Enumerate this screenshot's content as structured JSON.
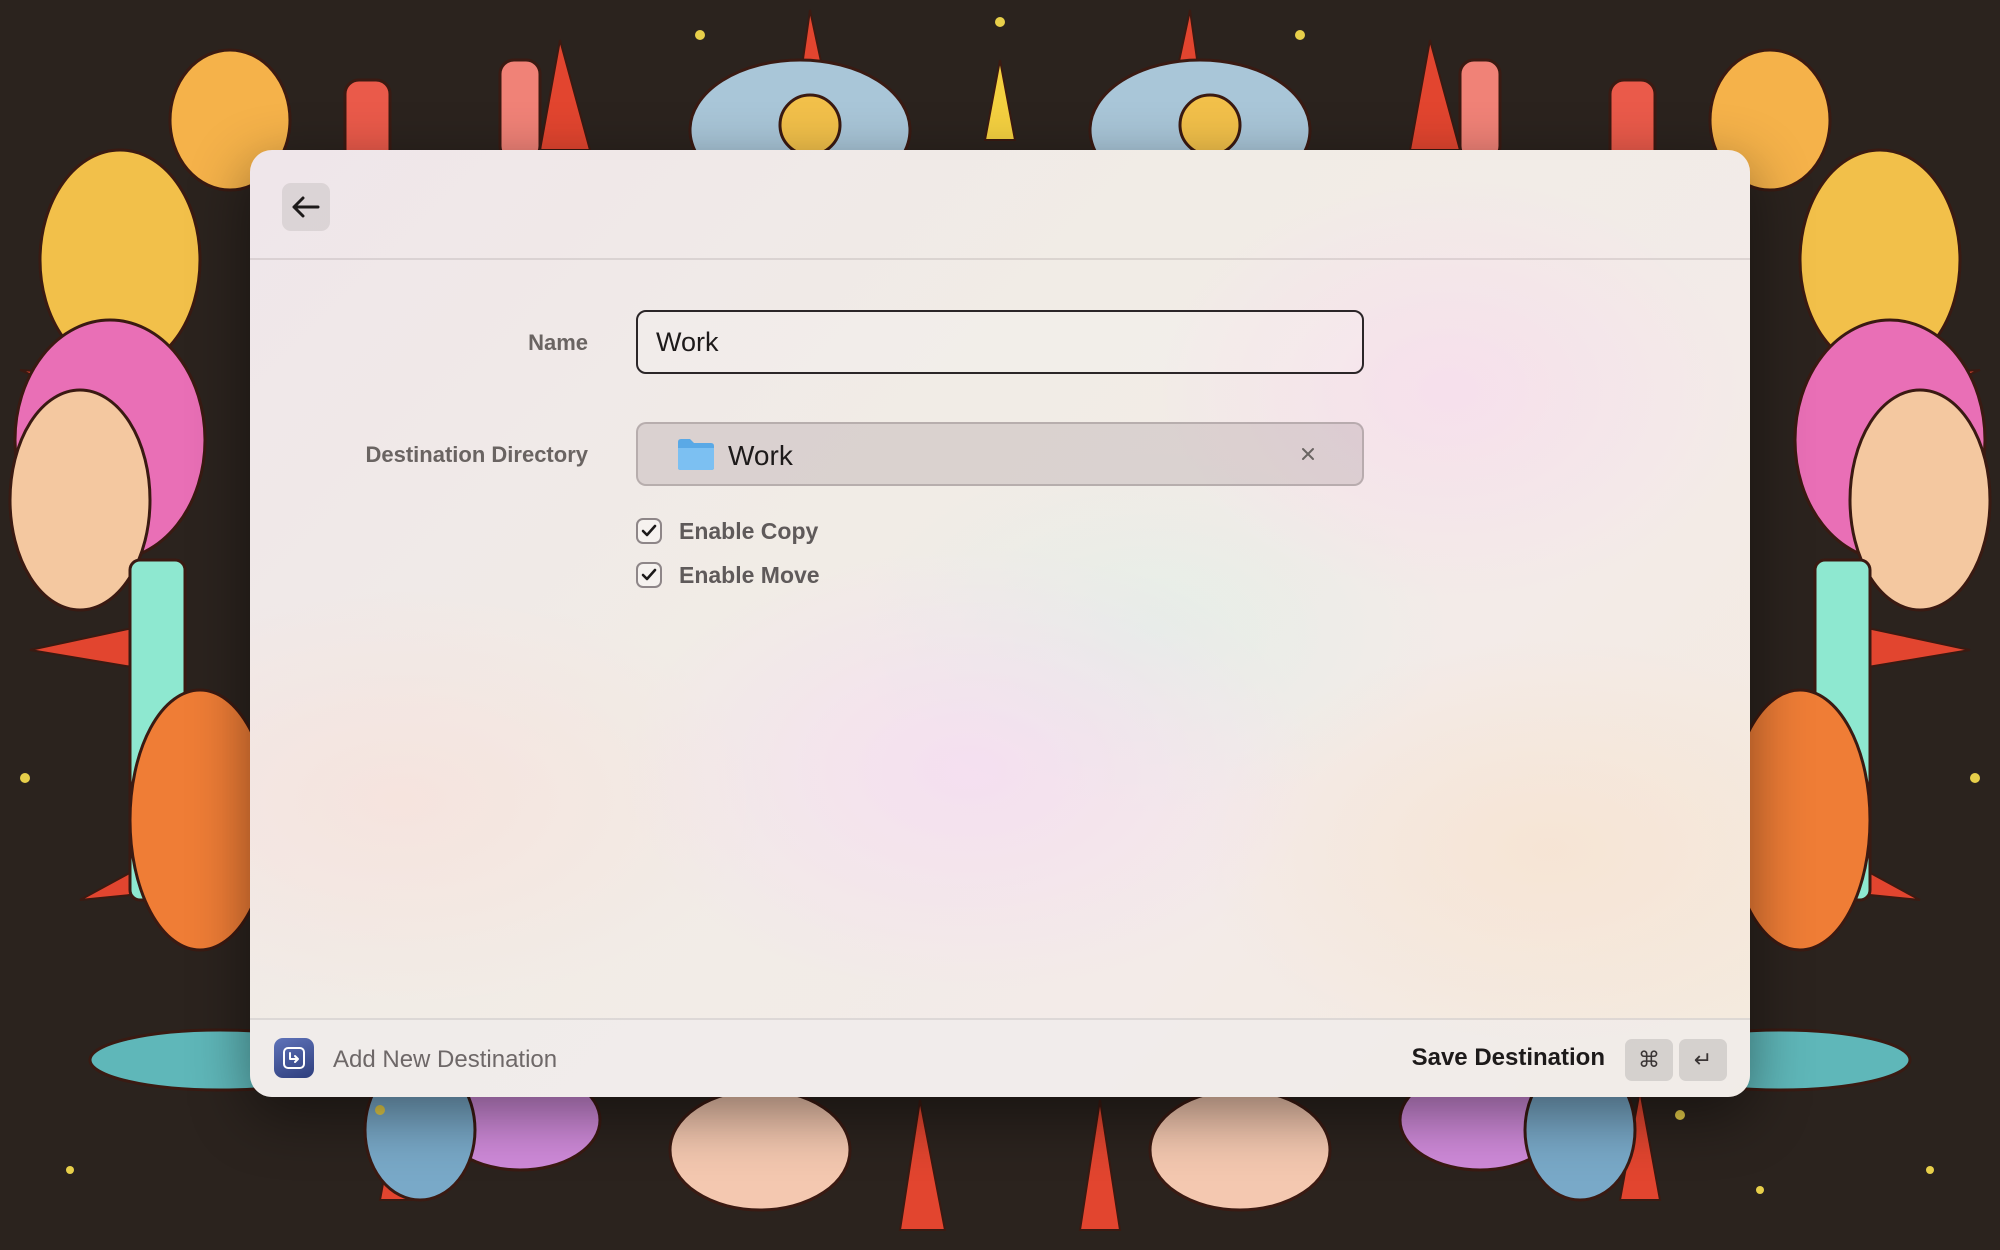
{
  "form": {
    "name_label": "Name",
    "name_value": "Work",
    "directory_label": "Destination Directory",
    "directory_value": "Work",
    "clear_icon": "close-icon",
    "folder_icon": "folder-icon",
    "options": [
      {
        "label": "Enable Copy",
        "checked": true
      },
      {
        "label": "Enable Move",
        "checked": true
      }
    ]
  },
  "toolbar": {
    "back_icon": "arrow-left-icon"
  },
  "footer": {
    "title": "Add New Destination",
    "action_label": "Save Destination",
    "shortcut_keys": [
      "⌘",
      "↵"
    ]
  },
  "colors": {
    "accent_app_icon": "#3f519a",
    "text_primary": "#1d1a1a",
    "text_secondary": "#6a6462"
  }
}
